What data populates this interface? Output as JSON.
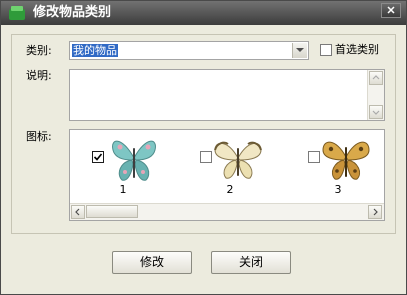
{
  "window": {
    "title": "修改物品类别"
  },
  "form": {
    "category_label": "类别:",
    "category_value": "我的物品",
    "preferred_label": "首选类别",
    "preferred_checked": false,
    "description_label": "说明:",
    "description_value": "",
    "icon_label": "图标:"
  },
  "icons": [
    {
      "number": "1",
      "checked": true,
      "icon": "teal-butterfly-icon",
      "color": "#7ec6c4"
    },
    {
      "number": "2",
      "checked": false,
      "icon": "cream-butterfly-icon",
      "color": "#f1e7c4"
    },
    {
      "number": "3",
      "checked": false,
      "icon": "golden-butterfly-icon",
      "color": "#d9a94a"
    }
  ],
  "buttons": {
    "modify": "修改",
    "close": "关闭"
  }
}
